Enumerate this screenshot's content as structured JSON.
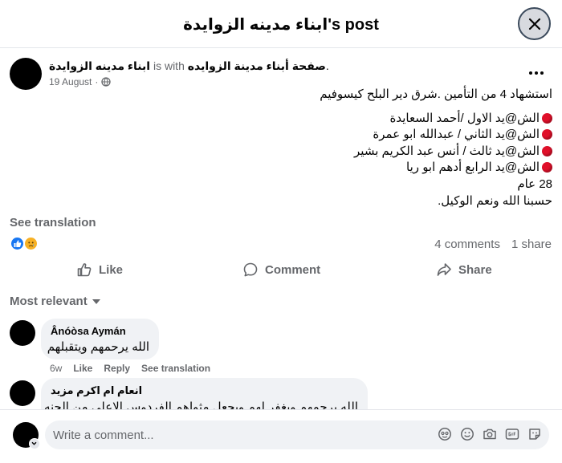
{
  "header": {
    "title": "ابناء مدينه الزوايدة's post"
  },
  "post": {
    "author": "ابناء مدينه الزوايدة",
    "with_text": "is with",
    "with_target": "صفحة أبناء مدينة الزوايده",
    "with_suffix": ".",
    "date": "19 August",
    "lines": [
      "استشهاد 4 من التأمين  .شرق دير البلح كيسوفيم",
      "الش@يد  الاول /أحمد السعايدة",
      "الش@يد الثاني / عبدالله ابو عمرة",
      "الش@يد ثالث / أنس عبد الكريم بشير",
      "الش@يد الرابع أدهم ابو ريا",
      "28 عام",
      "حسبنا الله ونعم الوكيل."
    ],
    "see_translation": "See translation",
    "comments_count": "4 comments",
    "shares_count": "1 share"
  },
  "actions": {
    "like": "Like",
    "comment": "Comment",
    "share": "Share"
  },
  "filter": {
    "label": "Most relevant"
  },
  "comments": [
    {
      "name": "Ânóòsa Aymán",
      "text": "الله يرحمهم ويتقبلهم",
      "time": "6w",
      "like": "Like",
      "reply": "Reply",
      "see_translation": "See translation"
    },
    {
      "name": "انعام ام اكرم مزيد",
      "text": "الله يرحمهم ويغفر لهم ويجعل مثواهم الفردوس الاعلى من الجنه"
    }
  ],
  "composer": {
    "placeholder": "Write a comment..."
  },
  "colors": {
    "like_blue": "#1877f2",
    "sad_yellow": "#f7b125",
    "dot_red": "#e0102a",
    "muted": "#65676b"
  }
}
